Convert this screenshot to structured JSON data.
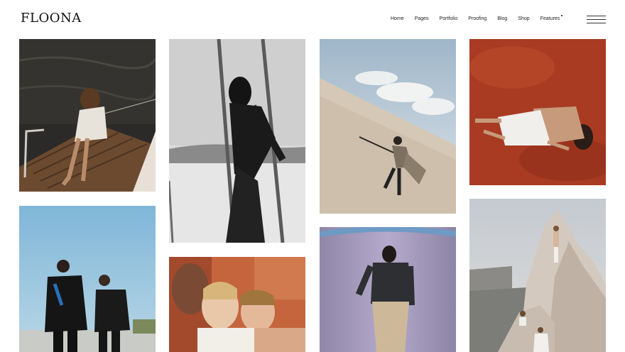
{
  "brand": {
    "logo_text": "FLOONA"
  },
  "nav": {
    "items": [
      {
        "label": "Home"
      },
      {
        "label": "Pages"
      },
      {
        "label": "Portfolio"
      },
      {
        "label": "Proofing"
      },
      {
        "label": "Blog"
      },
      {
        "label": "Shop"
      },
      {
        "label": "Features"
      }
    ]
  },
  "gallery": {
    "photos": [
      {
        "subject": "woman sitting on boat deck over dark water"
      },
      {
        "subject": "black and white model on swing at beach"
      },
      {
        "subject": "man with shovel on sand dune"
      },
      {
        "subject": "man lying on red earth"
      },
      {
        "subject": "two models in black outfits against blue sky"
      },
      {
        "subject": "group portrait of three models"
      },
      {
        "subject": "man facing purple wall"
      },
      {
        "subject": "figures on white rock formation"
      }
    ]
  }
}
